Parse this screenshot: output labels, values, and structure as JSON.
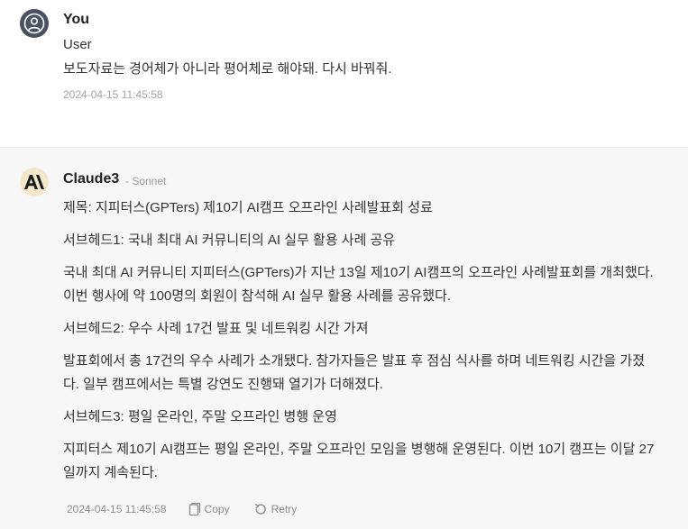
{
  "user_message": {
    "author": "You",
    "role_label": "User",
    "text": "보도자료는 경어체가 아니라 평어체로 해야돼. 다시 바꿔줘.",
    "timestamp": "2024-04-15 11:45:58",
    "avatar_icon": "user-icon"
  },
  "assistant_message": {
    "author": "Claude3",
    "model": "- Sonnet",
    "logo_icon": "anthropic-logo-icon",
    "paragraphs": [
      "제목: 지피터스(GPTers) 제10기 AI캠프 오프라인 사례발표회 성료",
      "서브헤드1: 국내 최대 AI 커뮤니티의 AI 실무 활용 사례 공유",
      "국내 최대 AI 커뮤니티 지피터스(GPTers)가 지난 13일 제10기 AI캠프의 오프라인 사례발표회를 개최했다. 이번 행사에 약 100명의 회원이 참석해 AI 실무 활용 사례를 공유했다.",
      "서브헤드2: 우수 사례 17건 발표 및 네트워킹 시간 가져",
      "발표회에서 총 17건의 우수 사례가 소개됐다. 참가자들은 발표 후 점심 식사를 하며 네트워킹 시간을 가졌다. 일부 캠프에서는 특별 강연도 진행돼 열기가 더해졌다.",
      "서브헤드3: 평일 온라인, 주말 오프라인 병행 운영",
      "지피터스 제10기 AI캠프는 평일 온라인, 주말 오프라인 모임을 병행해 운영된다. 이번 10기 캠프는 이달 27일까지 계속된다."
    ],
    "timestamp": "2024-04-15 11:45:58",
    "actions": {
      "copy_label": "Copy",
      "copy_icon": "copy-icon",
      "retry_label": "Retry",
      "retry_icon": "retry-icon"
    }
  },
  "colors": {
    "assistant_background": "#f7f7f8",
    "avatar_background": "#4b5162",
    "logo_background": "#f3e7c9",
    "timestamp_color": "#a3a3a3"
  }
}
